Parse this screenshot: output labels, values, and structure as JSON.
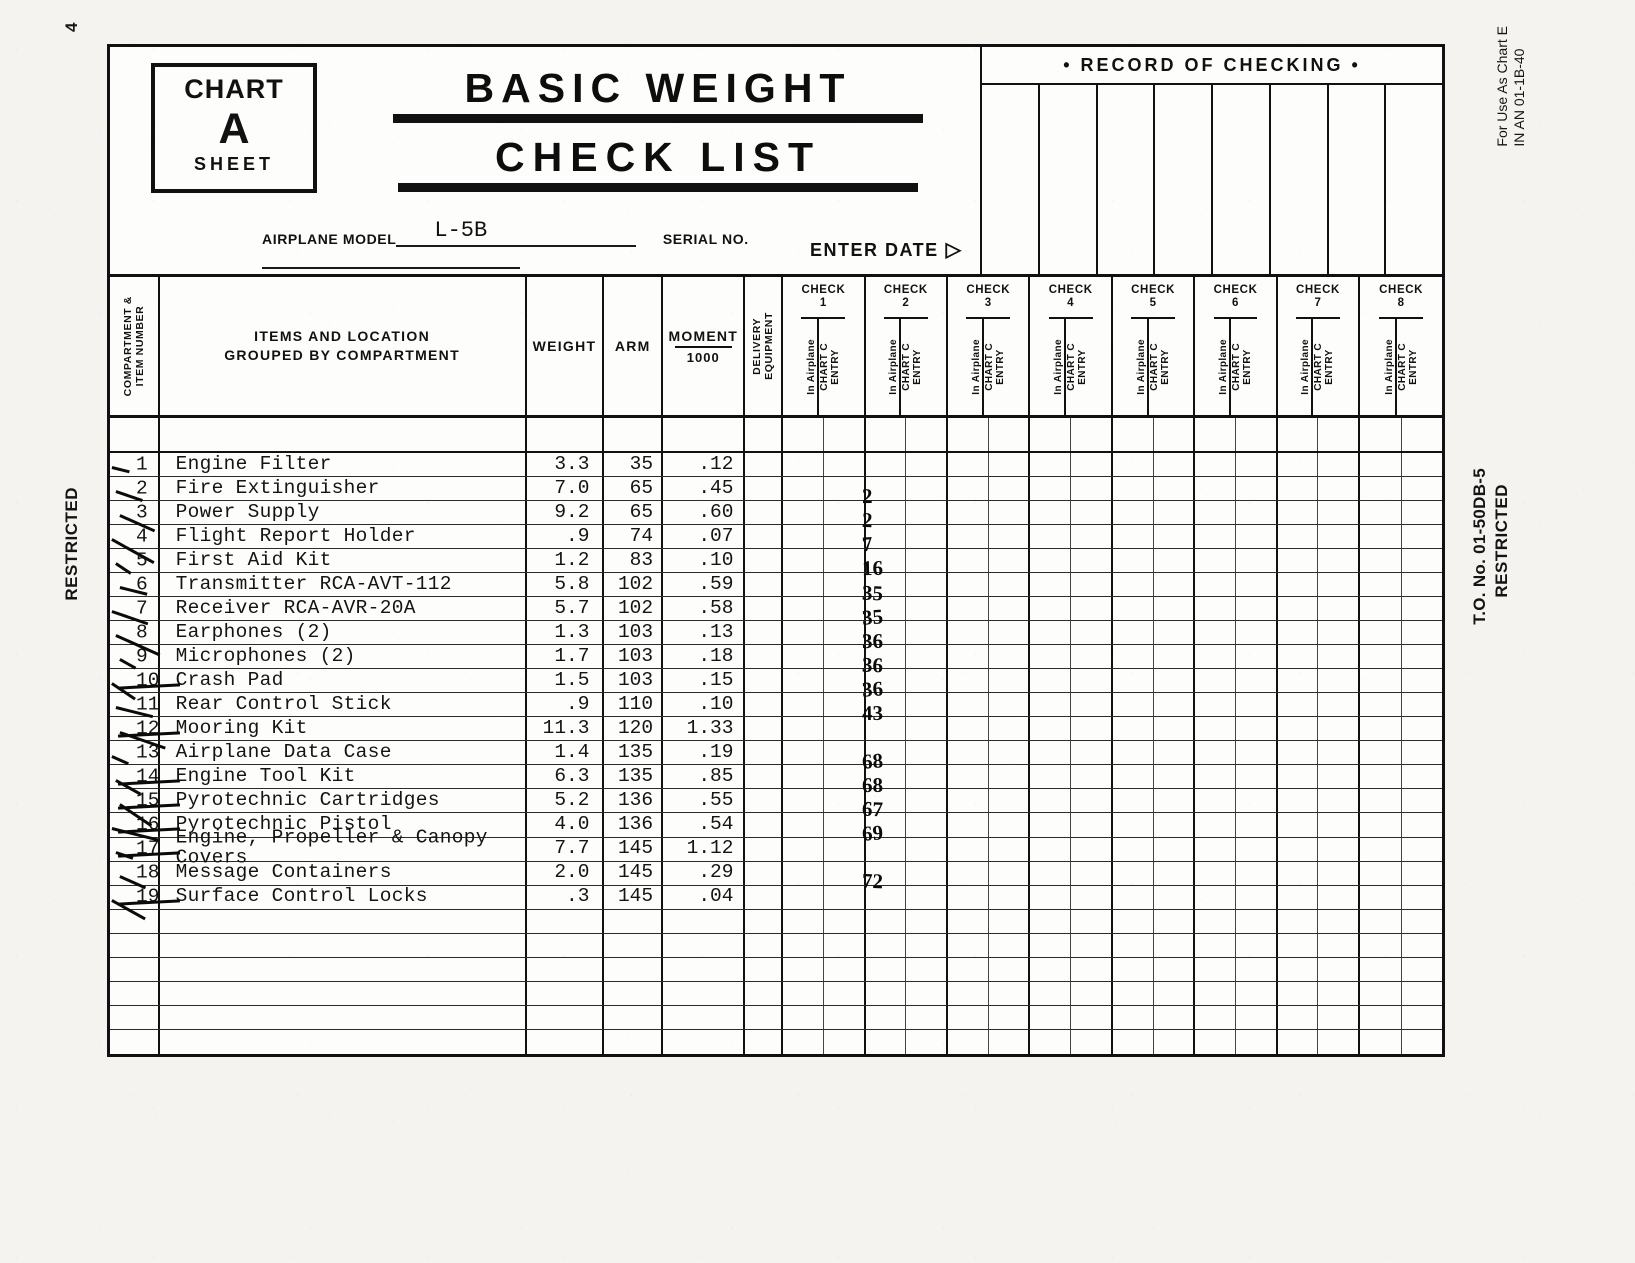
{
  "margins": {
    "page_number": "4",
    "left_classification": "RESTRICTED",
    "right_use_note": "For Use As Chart E\nIN AN 01-1B-40",
    "right_classification": "RESTRICTED",
    "right_to_number": "T.O. No. 01-50DB-5"
  },
  "header": {
    "chart_word": "CHART",
    "chart_letter": "A",
    "sheet_word": "SHEET",
    "title_line1": "BASIC WEIGHT",
    "title_line2": "CHECK LIST",
    "airplane_model_label": "AIRPLANE MODEL",
    "airplane_model_value": "L-5B",
    "serial_no_label": "SERIAL NO.",
    "serial_no_value": "",
    "enter_date_label": "ENTER DATE",
    "enter_date_arrow": "▷",
    "record_of_checking": "• RECORD OF CHECKING •"
  },
  "columns": {
    "number": "COMPARTMENT &\nITEM NUMBER",
    "number_line1": "COMPARTMENT &",
    "number_line2": "ITEM NUMBER",
    "items_line1": "ITEMS AND LOCATION",
    "items_line2": "GROUPED BY COMPARTMENT",
    "weight": "WEIGHT",
    "arm": "ARM",
    "moment_num": "MOMENT",
    "moment_den": "1000",
    "delivery_line1": "DELIVERY",
    "delivery_line2": "EQUIPMENT",
    "sub_in_airplane": "In Airplane",
    "sub_chart_c_line1": "CHART C",
    "sub_chart_c_line2": "ENTRY"
  },
  "check_headers": [
    {
      "label": "CHECK",
      "num": "1"
    },
    {
      "label": "CHECK",
      "num": "2"
    },
    {
      "label": "CHECK",
      "num": "3"
    },
    {
      "label": "CHECK",
      "num": "4"
    },
    {
      "label": "CHECK",
      "num": "5"
    },
    {
      "label": "CHECK",
      "num": "6"
    },
    {
      "label": "CHECK",
      "num": "7"
    },
    {
      "label": "CHECK",
      "num": "8"
    }
  ],
  "rows": [
    {
      "num": "1",
      "item": "Engine Filter",
      "weight": "3.3",
      "arm": "35",
      "moment": ".12",
      "struck": false,
      "pen_arm": "",
      "pen_mom": ""
    },
    {
      "num": "2",
      "item": "Fire Extinguisher",
      "weight": "7.0",
      "arm": "65",
      "moment": ".45",
      "struck": false,
      "pen_arm": "",
      "pen_mom": "2"
    },
    {
      "num": "3",
      "item": "Power Supply",
      "weight": "9.2",
      "arm": "65",
      "moment": ".60",
      "struck": false,
      "pen_arm": "",
      "pen_mom": "2"
    },
    {
      "num": "4",
      "item": "Flight Report Holder",
      "weight": ".9",
      "arm": "74",
      "moment": ".07",
      "struck": false,
      "pen_arm": "",
      "pen_mom": "7"
    },
    {
      "num": "5",
      "item": "First Aid Kit",
      "weight": "1.2",
      "arm": "83",
      "moment": ".10",
      "struck": false,
      "pen_arm": "",
      "pen_mom": "16"
    },
    {
      "num": "6",
      "item": "Transmitter RCA-AVT-112",
      "weight": "5.8",
      "arm": "102",
      "moment": ".59",
      "struck": false,
      "pen_arm": "",
      "pen_mom": "35"
    },
    {
      "num": "7",
      "item": "Receiver RCA-AVR-20A",
      "weight": "5.7",
      "arm": "102",
      "moment": ".58",
      "struck": false,
      "pen_arm": "",
      "pen_mom": "35"
    },
    {
      "num": "8",
      "item": "Earphones (2)",
      "weight": "1.3",
      "arm": "103",
      "moment": ".13",
      "struck": false,
      "pen_arm": "",
      "pen_mom": "36"
    },
    {
      "num": "9",
      "item": "Microphones (2)",
      "weight": "1.7",
      "arm": "103",
      "moment": ".18",
      "struck": false,
      "pen_arm": "",
      "pen_mom": "36"
    },
    {
      "num": "10",
      "item": "Crash Pad",
      "weight": "1.5",
      "arm": "103",
      "moment": ".15",
      "struck": true,
      "pen_arm": "",
      "pen_mom": "36"
    },
    {
      "num": "11",
      "item": "Rear Control Stick",
      "weight": ".9",
      "arm": "110",
      "moment": ".10",
      "struck": false,
      "pen_arm": "",
      "pen_mom": "43"
    },
    {
      "num": "12",
      "item": "Mooring Kit",
      "weight": "11.3",
      "arm": "120",
      "moment": "1.33",
      "struck": true,
      "pen_arm": "",
      "pen_mom": ""
    },
    {
      "num": "13",
      "item": "Airplane Data Case",
      "weight": "1.4",
      "arm": "135",
      "moment": ".19",
      "struck": false,
      "pen_arm": "",
      "pen_mom": "68"
    },
    {
      "num": "14",
      "item": "Engine Tool Kit",
      "weight": "6.3",
      "arm": "135",
      "moment": ".85",
      "struck": true,
      "pen_arm": "",
      "pen_mom": "68"
    },
    {
      "num": "15",
      "item": "Pyrotechnic Cartridges",
      "weight": "5.2",
      "arm": "136",
      "moment": ".55",
      "struck": true,
      "pen_arm": "",
      "pen_mom": "67"
    },
    {
      "num": "16",
      "item": "Pyrotechnic Pistol",
      "weight": "4.0",
      "arm": "136",
      "moment": ".54",
      "struck": true,
      "pen_arm": "",
      "pen_mom": "69"
    },
    {
      "num": "17",
      "item": "Engine, Propeller & Canopy Covers",
      "weight": "7.7",
      "arm": "145",
      "moment": "1.12",
      "struck": true,
      "pen_arm": "",
      "pen_mom": ""
    },
    {
      "num": "18",
      "item": "Message Containers",
      "weight": "2.0",
      "arm": "145",
      "moment": ".29",
      "struck": false,
      "pen_arm": "",
      "pen_mom": "72"
    },
    {
      "num": "19",
      "item": "Surface Control Locks",
      "weight": ".3",
      "arm": "145",
      "moment": ".04",
      "struck": true,
      "pen_arm": "",
      "pen_mom": ""
    },
    {
      "num": "",
      "item": "",
      "weight": "",
      "arm": "",
      "moment": "",
      "struck": false,
      "pen_arm": "",
      "pen_mom": ""
    },
    {
      "num": "",
      "item": "",
      "weight": "",
      "arm": "",
      "moment": "",
      "struck": false,
      "pen_arm": "",
      "pen_mom": ""
    },
    {
      "num": "",
      "item": "",
      "weight": "",
      "arm": "",
      "moment": "",
      "struck": false,
      "pen_arm": "",
      "pen_mom": ""
    },
    {
      "num": "",
      "item": "",
      "weight": "",
      "arm": "",
      "moment": "",
      "struck": false,
      "pen_arm": "",
      "pen_mom": ""
    },
    {
      "num": "",
      "item": "",
      "weight": "",
      "arm": "",
      "moment": "",
      "struck": false,
      "pen_arm": "",
      "pen_mom": ""
    },
    {
      "num": "",
      "item": "",
      "weight": "",
      "arm": "",
      "moment": "",
      "struck": false,
      "pen_arm": "",
      "pen_mom": ""
    }
  ],
  "colors": {
    "ink": "#111111",
    "paper": "#fdfdfb",
    "rule": "#2b2b2b"
  }
}
